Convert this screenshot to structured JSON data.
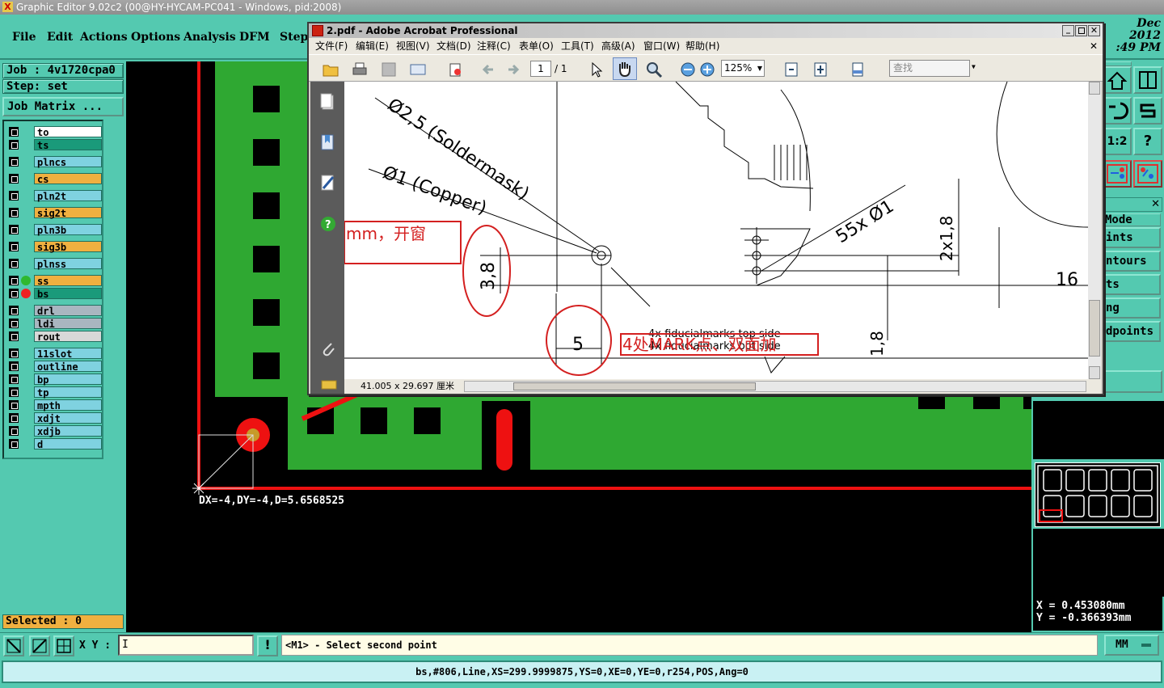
{
  "app": {
    "title": "Graphic Editor 9.02c2 (00@HY-HYCAM-PC041 - Windows, pid:2008)",
    "clock_date": "Dec 2012",
    "clock_time": ":49 PM"
  },
  "menu": [
    "File",
    "Edit",
    "Actions",
    "Options",
    "Analysis",
    "DFM",
    "Step"
  ],
  "job": {
    "label": "Job : 4v1720cpa0",
    "step": "Step: set",
    "matrix_button": "Job Matrix ..."
  },
  "layers": [
    {
      "name": "to",
      "color": "#ffffff",
      "dot": ""
    },
    {
      "name": "ts",
      "color": "#1a9a7a",
      "dot": ""
    },
    {
      "name": "plncs",
      "color": "#7fd2e0",
      "dot": ""
    },
    {
      "name": "cs",
      "color": "#f0b040",
      "dot": ""
    },
    {
      "name": "pln2t",
      "color": "#7fd2e0",
      "dot": ""
    },
    {
      "name": "sig2t",
      "color": "#f0b040",
      "dot": ""
    },
    {
      "name": "pln3b",
      "color": "#7fd2e0",
      "dot": ""
    },
    {
      "name": "sig3b",
      "color": "#f0b040",
      "dot": ""
    },
    {
      "name": "plnss",
      "color": "#7fd2e0",
      "dot": ""
    },
    {
      "name": "ss",
      "color": "#f0b040",
      "dot": "#2fb82f"
    },
    {
      "name": "bs",
      "color": "#1a9a7a",
      "dot": "#ee2222"
    },
    {
      "name": "drl",
      "color": "#a9b6c0",
      "dot": ""
    },
    {
      "name": "ldi",
      "color": "#a9b6c0",
      "dot": ""
    },
    {
      "name": "rout",
      "color": "#d8d8d8",
      "dot": ""
    },
    {
      "name": "11slot",
      "color": "#7fd2e0",
      "dot": ""
    },
    {
      "name": "outline",
      "color": "#7fd2e0",
      "dot": ""
    },
    {
      "name": "bp",
      "color": "#7fd2e0",
      "dot": ""
    },
    {
      "name": "tp",
      "color": "#7fd2e0",
      "dot": ""
    },
    {
      "name": "mpth",
      "color": "#7fd2e0",
      "dot": ""
    },
    {
      "name": "xdjt",
      "color": "#7fd2e0",
      "dot": ""
    },
    {
      "name": "xdjb",
      "color": "#7fd2e0",
      "dot": ""
    },
    {
      "name": "d",
      "color": "#7fd2e0",
      "dot": ""
    }
  ],
  "selected": "Selected : 0",
  "measure": "DX=-4,DY=-4,D=5.6568525",
  "right_panel": {
    "list": [
      "Mode",
      "ints",
      "ntours",
      "ts",
      "ng",
      "dpoints"
    ],
    "ratio_label": "1:2",
    "help_label": "?"
  },
  "coords": {
    "x": "X = 0.453080mm",
    "y": "Y = -0.366393mm"
  },
  "bottom": {
    "xy_label": "X Y :",
    "xy_value": "I",
    "exclaim": "!",
    "prompt": "<M1> - Select second point",
    "units": "MM"
  },
  "status": "bs,#806,Line,XS=299.9999875,YS=0,XE=0,YE=0,r254,POS,Ang=0",
  "acrobat": {
    "title": "2.pdf - Adobe Acrobat Professional",
    "menu": [
      "文件(F)",
      "编辑(E)",
      "视图(V)",
      "文档(D)",
      "注释(C)",
      "表单(O)",
      "工具(T)",
      "高级(A)",
      "窗口(W)",
      "帮助(H)"
    ],
    "page_current": "1",
    "page_total": "/ 1",
    "zoom": "125%",
    "search_placeholder": "查找",
    "page_size": "41.005 x 29.697 厘米",
    "drawing": {
      "soldermask": "Ø2,5 (Soldermask)",
      "copper": "Ø1 (Copper)",
      "fid_top": "4x fiducialmarks top side",
      "fid_bot": "4x fiducialmarks bot side",
      "dim_38": "3,8",
      "dim_5": "5",
      "dim_18": "1,8",
      "dim_2x18": "2x1,8",
      "dim_55": "55x Ø1",
      "dim_16": "16",
      "note1": "mm，开窗",
      "note2": "4处MARK点、双面加"
    }
  },
  "colors": {
    "teal": "#54c9b0",
    "pcb_green": "#2fa832",
    "trace_red": "#ee1111",
    "annot_red": "#d42020"
  }
}
